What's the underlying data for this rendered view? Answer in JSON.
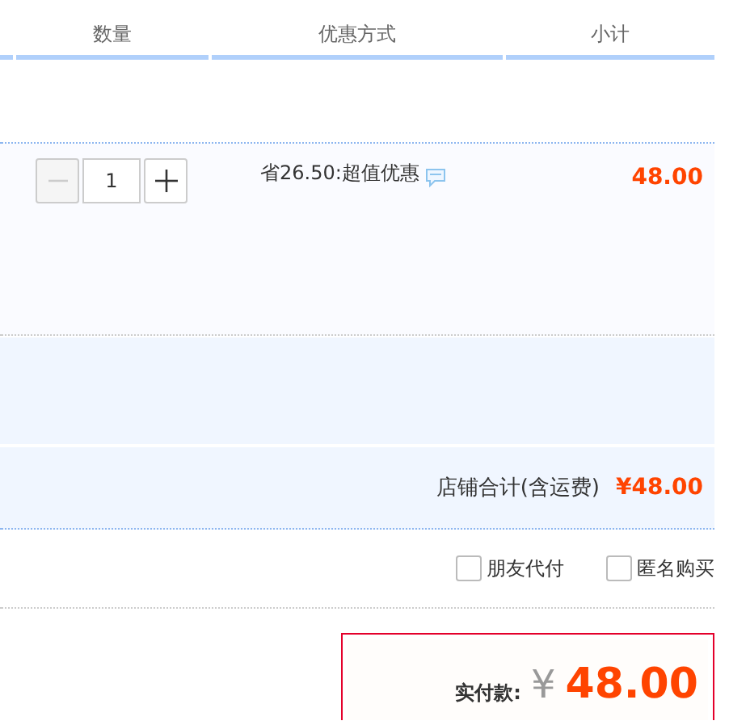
{
  "table": {
    "columns": [
      "数量",
      "优惠方式",
      "小计"
    ]
  },
  "item": {
    "quantity": "1",
    "decrease_disabled": true,
    "discount": "省26.50:超值优惠",
    "subtotal": "48.00"
  },
  "store_total": {
    "label": "店铺合计(含运费)",
    "amount": "¥48.00"
  },
  "options": [
    {
      "label": "朋友代付",
      "checked": false
    },
    {
      "label": "匿名购买",
      "checked": false
    }
  ],
  "payment": {
    "label": "实付款:",
    "currency": "¥",
    "amount": "48.00"
  }
}
